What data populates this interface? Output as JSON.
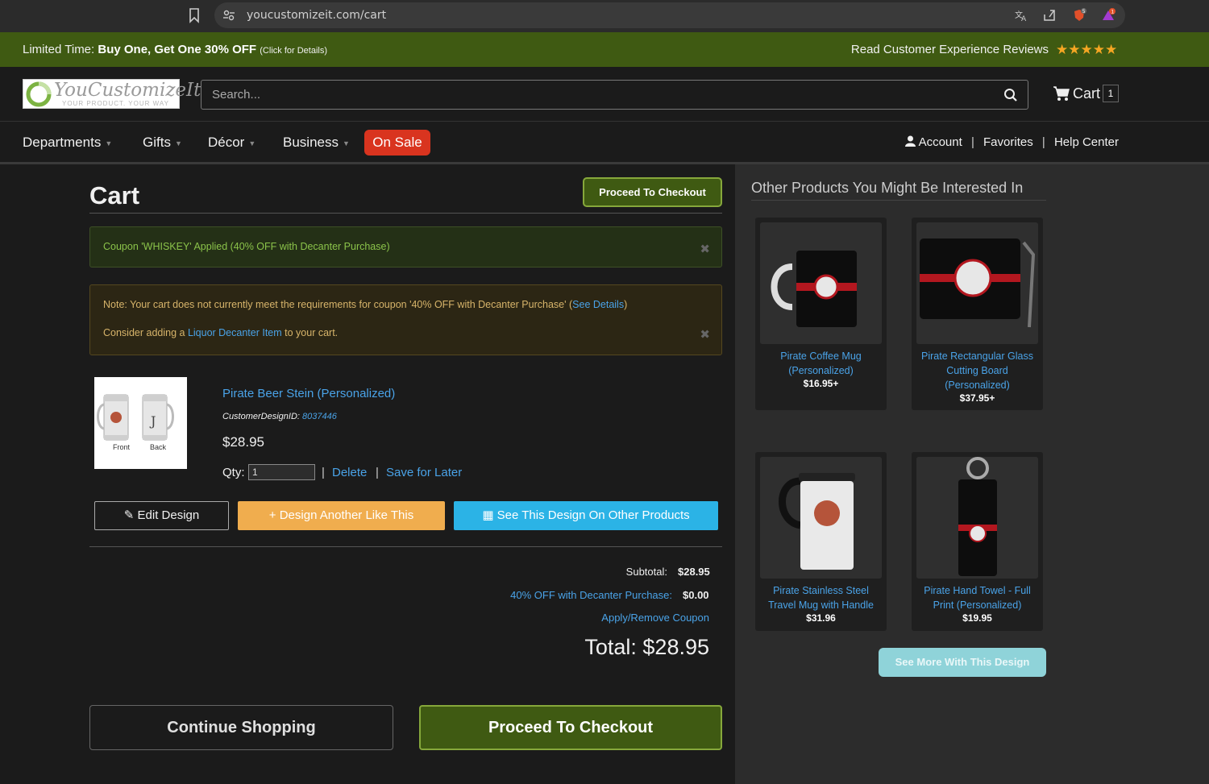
{
  "browser": {
    "url": "youcustomizeit.com/cart",
    "shield_badge": "5",
    "alert_badge": "1"
  },
  "promo": {
    "prefix": "Limited Time:",
    "offer": "Buy One, Get One 30% OFF",
    "note": "(Click for Details)",
    "reviews": "Read Customer Experience Reviews",
    "rating": 5
  },
  "header": {
    "logo_name": "YouCustomizeIt",
    "logo_tagline": "YOUR PRODUCT. YOUR WAY",
    "search_placeholder": "Search...",
    "cart_label": "Cart",
    "cart_count": "1"
  },
  "nav": {
    "departments": "Departments",
    "gifts": "Gifts",
    "decor": "Décor",
    "business": "Business",
    "on_sale": "On Sale",
    "account": "Account",
    "favorites": "Favorites",
    "help": "Help Center"
  },
  "cart": {
    "title": "Cart",
    "checkout_top": "Proceed To Checkout",
    "coupon_applied": "Coupon 'WHISKEY' Applied (40% OFF with Decanter Purchase)",
    "note_text": "Note: Your cart does not currently meet the requirements for coupon '40% OFF with Decanter Purchase' (",
    "note_link": "See Details",
    "note_end": ")",
    "consider_pre": "Consider adding a ",
    "consider_link": "Liquor Decanter Item",
    "consider_post": " to your cart.",
    "item": {
      "img_front": "Front",
      "img_back": "Back",
      "name": "Pirate Beer Stein (Personalized)",
      "design_id_label": "CustomerDesignID: ",
      "design_id": "8037446",
      "price": "$28.95",
      "qty_label": "Qty:",
      "qty": "1",
      "delete": "Delete",
      "save_later": "Save for Later"
    },
    "edit_design": "Edit Design",
    "design_another": "Design Another Like This",
    "see_other": "See This Design On Other Products",
    "subtotal_label": "Subtotal:",
    "subtotal": "$28.95",
    "discount_label": "40% OFF with Decanter Purchase:",
    "discount": "$0.00",
    "coupon_link": "Apply/Remove Coupon",
    "total": "Total: $28.95",
    "continue": "Continue Shopping",
    "checkout_bottom": "Proceed To Checkout"
  },
  "sidebar": {
    "title": "Other Products You Might Be Interested In",
    "products": [
      {
        "title": "Pirate Coffee Mug (Personalized)",
        "price": "$16.95+"
      },
      {
        "title": "Pirate Rectangular Glass Cutting Board (Personalized)",
        "price": "$37.95+"
      },
      {
        "title": "Pirate Stainless Steel Travel Mug with Handle",
        "price": "$31.96"
      },
      {
        "title": "Pirate Hand Towel - Full Print (Personalized)",
        "price": "$19.95"
      }
    ],
    "see_more": "See More With This Design"
  },
  "colors": {
    "brand_green": "#3f5a12",
    "link_blue": "#4aa3e8",
    "sale_red": "#d9341f",
    "orange": "#f0ad4e",
    "cyan": "#2bb3e6"
  }
}
